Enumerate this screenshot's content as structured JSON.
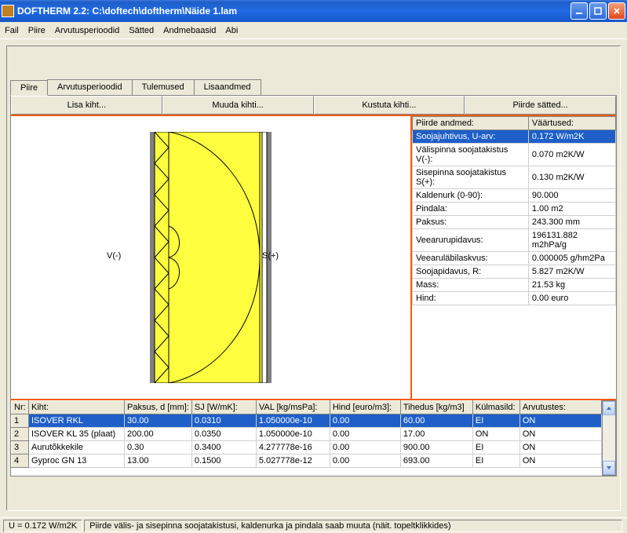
{
  "window": {
    "title": "DOFTHERM 2.2: C:\\doftech\\doftherm\\Näide 1.lam"
  },
  "menu": [
    "Fail",
    "Piire",
    "Arvutusperioodid",
    "Sätted",
    "Andmebaasid",
    "Abi"
  ],
  "tabs": [
    "Piire",
    "Arvutusperioodid",
    "Tulemused",
    "Lisaandmed"
  ],
  "buttons": {
    "add": "Lisa kiht...",
    "edit": "Muuda kihti...",
    "delete": "Kustuta kihti...",
    "settings": "Piirde sätted..."
  },
  "diagram": {
    "left_label": "V(-)",
    "right_label": "S(+)"
  },
  "props_headers": {
    "name": "Piirde andmed:",
    "value": "Väärtused:"
  },
  "props": [
    {
      "name": "Soojajuhtivus, U-arv:",
      "value": "0.172 W/m2K",
      "selected": true
    },
    {
      "name": "Välispinna soojatakistus V(-):",
      "value": "0.070 m2K/W"
    },
    {
      "name": "Sisepinna soojatakistus S(+):",
      "value": "0.130 m2K/W"
    },
    {
      "name": "Kaldenurk (0-90):",
      "value": "90.000"
    },
    {
      "name": "Pindala:",
      "value": "1.00 m2"
    },
    {
      "name": "Paksus:",
      "value": "243.300 mm"
    },
    {
      "name": "Veearurupidavus:",
      "value": "196131.882 m2hPa/g"
    },
    {
      "name": "Veearuläbilaskvus:",
      "value": "0.000005 g/hm2Pa"
    },
    {
      "name": "Soojapidavus, R:",
      "value": "5.827 m2K/W"
    },
    {
      "name": "Mass:",
      "value": "21.53 kg"
    },
    {
      "name": "Hind:",
      "value": "0.00 euro"
    }
  ],
  "layer_headers": [
    "Nr:",
    "Kiht:",
    "Paksus, d [mm]:",
    "SJ [W/mK]:",
    "VAL [kg/msPa]:",
    "Hind [euro/m3]:",
    "Tihedus [kg/m3]",
    "Külmasild:",
    "Arvutustes:"
  ],
  "layers": [
    {
      "nr": "1",
      "kiht": "ISOVER RKL",
      "paksus": "30.00",
      "sj": "0.0310",
      "val": "1.050000e-10",
      "hind": "0.00",
      "tihedus": "60.00",
      "kulmasild": "EI",
      "arvutustes": "ON",
      "selected": true
    },
    {
      "nr": "2",
      "kiht": "ISOVER KL 35 (plaat)",
      "paksus": "200.00",
      "sj": "0.0350",
      "val": "1.050000e-10",
      "hind": "0.00",
      "tihedus": "17.00",
      "kulmasild": "ON",
      "arvutustes": "ON"
    },
    {
      "nr": "3",
      "kiht": "Aurutõkkekile",
      "paksus": "0.30",
      "sj": "0.3400",
      "val": "4.277778e-16",
      "hind": "0.00",
      "tihedus": "900.00",
      "kulmasild": "EI",
      "arvutustes": "ON"
    },
    {
      "nr": "4",
      "kiht": "Gyproc GN 13",
      "paksus": "13.00",
      "sj": "0.1500",
      "val": "5.027778e-12",
      "hind": "0.00",
      "tihedus": "693.00",
      "kulmasild": "EI",
      "arvutustes": "ON"
    }
  ],
  "statusbar": {
    "u_value": "U = 0.172 W/m2K",
    "hint": "Piirde välis- ja sisepinna soojatakistusi, kaldenurka ja pindala saab muuta (näit. topeltklikkides)"
  }
}
